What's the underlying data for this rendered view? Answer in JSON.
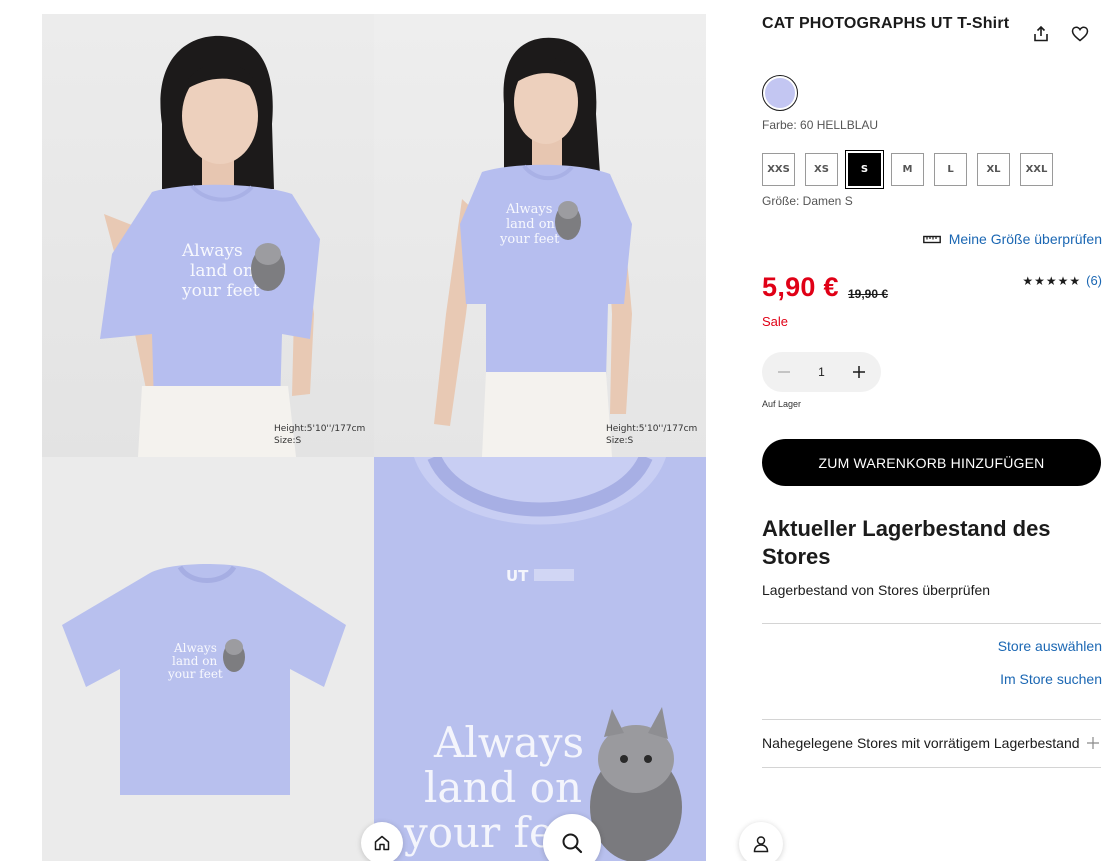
{
  "product": {
    "title": "CAT PHOTOGRAPHS UT T-Shirt",
    "color_label": "Farbe: 60 HELLBLAU",
    "swatch_color": "#c3c6f2",
    "sizes": [
      "XXS",
      "XS",
      "S",
      "M",
      "L",
      "XL",
      "XXL"
    ],
    "selected_size": "S",
    "size_label": "Größe: Damen S",
    "size_check_link": "Meine Größe überprüfen",
    "price": "5,90 €",
    "old_price": "19,90 €",
    "sale_label": "Sale",
    "rating": 4.5,
    "stars": "★★★★★",
    "review_count": "(6)",
    "quantity": "1",
    "stock_status": "Auf Lager",
    "add_to_cart": "ZUM WARENKORB HINZUFÜGEN"
  },
  "gallery": {
    "images": [
      {
        "name": "model-front-1",
        "caption": [
          "Height:5'10''/177cm",
          "Size:S"
        ]
      },
      {
        "name": "model-front-2",
        "caption": [
          "Height:5'10''/177cm",
          "Size:S"
        ]
      },
      {
        "name": "flat-lay",
        "caption": []
      },
      {
        "name": "print-closeup",
        "caption": []
      }
    ],
    "print_text": [
      "Always",
      "land on",
      "your feet"
    ],
    "label_text": "UT"
  },
  "store": {
    "heading": "Aktueller Lagerbestand des Stores",
    "subheading": "Lagerbestand von Stores überprüfen",
    "select_store": "Store auswählen",
    "search_store": "Im Store suchen",
    "nearby": "Nahegelegene Stores mit vorrätigem Lagerbestand"
  },
  "colors": {
    "price_red": "#e00016",
    "link_blue": "#1b67b3",
    "shirt_lavender": "#b8c0ee"
  },
  "nav": {
    "icons": [
      "home-icon",
      "search-icon",
      "account-icon"
    ]
  }
}
